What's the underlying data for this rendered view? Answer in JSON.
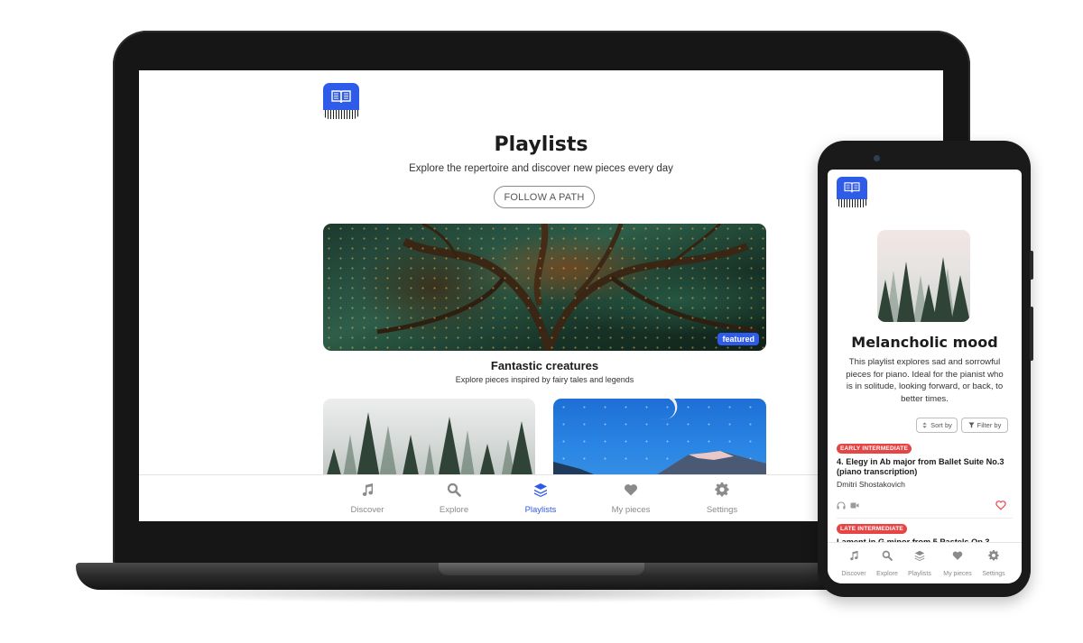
{
  "colors": {
    "accent": "#2f5bea",
    "badge_red": "#e64545",
    "text": "#1c1c1e",
    "muted": "#8a8a8a"
  },
  "laptop": {
    "header": {
      "title": "Playlists",
      "subtitle": "Explore the repertoire and discover new pieces every day",
      "follow_button": "FOLLOW A PATH"
    },
    "featured": {
      "badge": "featured",
      "title": "Fantastic creatures",
      "subtitle": "Explore pieces inspired by fairy tales and legends"
    },
    "nav": [
      {
        "label": "Discover",
        "icon": "music-note-icon",
        "active": false
      },
      {
        "label": "Explore",
        "icon": "search-icon",
        "active": false
      },
      {
        "label": "Playlists",
        "icon": "layers-icon",
        "active": true
      },
      {
        "label": "My pieces",
        "icon": "heart-icon",
        "active": false
      },
      {
        "label": "Settings",
        "icon": "gear-icon",
        "active": false
      }
    ]
  },
  "phone": {
    "playlist": {
      "title": "Melancholic mood",
      "description": "This playlist explores sad and sorrowful pieces for piano. Ideal for the pianist who is in solitude, looking forward, or back, to better times."
    },
    "controls": {
      "sort": "Sort by",
      "filter": "Filter by"
    },
    "pieces": [
      {
        "level": "EARLY INTERMEDIATE",
        "title": "4. Elegy in Ab major from Ballet Suite No.3 (piano transcription)",
        "composer": "Dmitri Shostakovich"
      },
      {
        "level": "LATE INTERMEDIATE",
        "title": "Lament in G minor from 5 Pastels Op.3"
      }
    ],
    "nav": [
      {
        "label": "Discover",
        "icon": "music-note-icon"
      },
      {
        "label": "Explore",
        "icon": "search-icon"
      },
      {
        "label": "Playlists",
        "icon": "layers-icon"
      },
      {
        "label": "My pieces",
        "icon": "heart-icon"
      },
      {
        "label": "Settings",
        "icon": "gear-icon"
      }
    ]
  }
}
